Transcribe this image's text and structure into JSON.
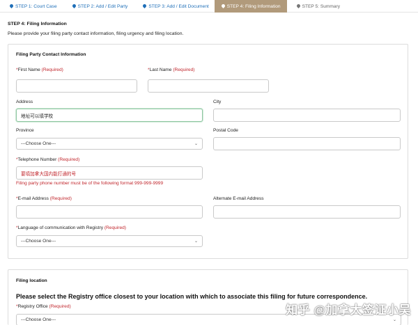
{
  "steps": [
    {
      "label": "STEP 1: Court Case"
    },
    {
      "label": "STEP 2: Add / Edit Party"
    },
    {
      "label": "STEP 3: Add / Edit Document"
    },
    {
      "label": "STEP 4: Filing Information"
    },
    {
      "label": "STEP 5: Summary"
    }
  ],
  "page": {
    "title": "STEP 4: Filing Information",
    "intro": "Please provide your filing party contact information, filing urgency and filing location."
  },
  "contact": {
    "heading": "Filing Party Contact Information",
    "first_name": {
      "label": "First Name",
      "required": "(Required)",
      "value": ""
    },
    "last_name": {
      "label": "Last Name",
      "required": "(Required)",
      "value": ""
    },
    "address": {
      "label": "Address",
      "value": "地址可以填学校"
    },
    "city": {
      "label": "City",
      "value": ""
    },
    "province": {
      "label": "Province",
      "selected": "---Choose One---"
    },
    "postal_code": {
      "label": "Postal Code",
      "value": ""
    },
    "telephone": {
      "label": "Telephone Number",
      "required": "(Required)",
      "value": "要填加拿大国内能打通的号",
      "error": "Filing party phone number must be of the following format 999-999-9999"
    },
    "email": {
      "label": "E-mail Address",
      "required": "(Required)",
      "value": ""
    },
    "alt_email": {
      "label": "Alternate E-mail Address",
      "value": ""
    },
    "language": {
      "label": "Language of communication with Registry",
      "required": "(Required)",
      "selected": "---Choose One---"
    }
  },
  "location": {
    "heading": "Filing location",
    "instruction": "Please select the Registry office closest to your location with which to associate this filing for future correspondence.",
    "registry": {
      "label": "Registry Office",
      "required": "(Required)",
      "selected": "---Choose One---"
    }
  },
  "required_marker": "*",
  "watermark": "知乎 @加拿大签证小吴",
  "colors": {
    "active_step_bg": "#b19a7b",
    "link_blue": "#1f6fb8",
    "required_red": "#c1272d"
  }
}
